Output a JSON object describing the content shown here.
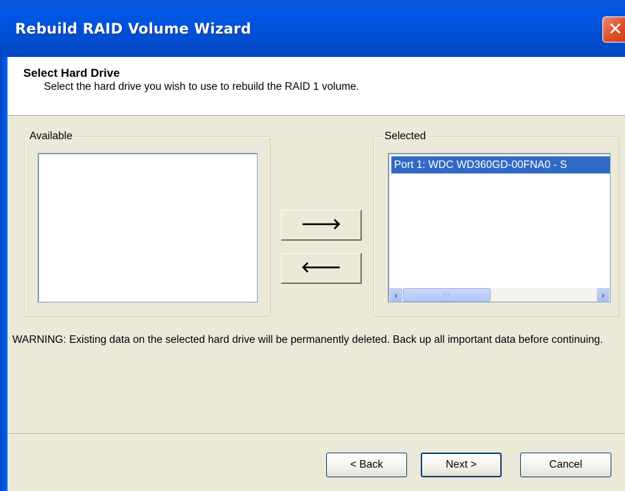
{
  "window": {
    "title": "Rebuild RAID Volume Wizard",
    "close_glyph": "✕"
  },
  "header": {
    "heading": "Select Hard Drive",
    "subtitle": "Select the hard drive you wish to use to rebuild the RAID 1 volume."
  },
  "available": {
    "label": "Available",
    "items": []
  },
  "selected": {
    "label": "Selected",
    "items": [
      "Port 1: WDC WD360GD-00FNA0 - S"
    ]
  },
  "scrollbar": {
    "left_icon": "‹",
    "right_icon": "›",
    "thumb_grip": "III"
  },
  "transfer": {
    "add_icon": "🡒",
    "remove_icon": "🡐"
  },
  "warning": "WARNING: Existing data on the selected hard drive will be permanently deleted. Back up all important data before continuing.",
  "buttons": {
    "back": "< Back",
    "next": "Next >",
    "cancel": "Cancel"
  },
  "colors": {
    "titlebar": "#0058e6",
    "selection": "#316ac5",
    "face": "#ece9d8"
  }
}
